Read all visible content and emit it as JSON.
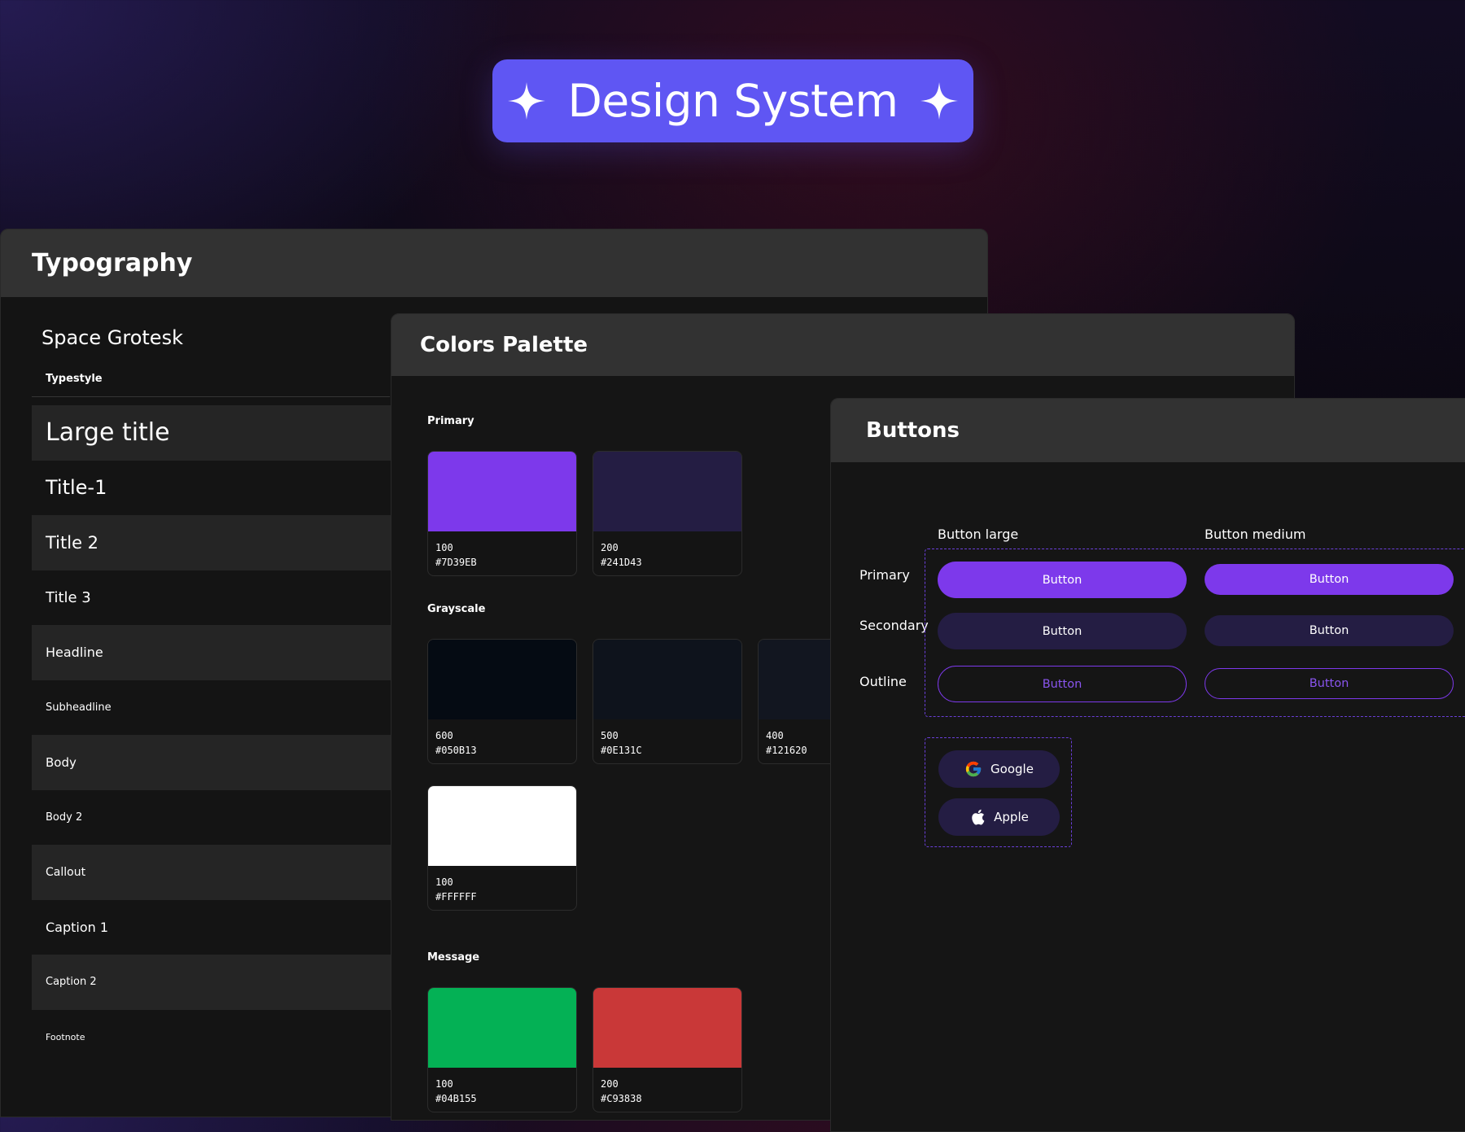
{
  "header": {
    "title": "Design System",
    "icon": "sparkle-icon",
    "accent_color": "#5F56F3"
  },
  "typography": {
    "title": "Typography",
    "font_name": "Space Grotesk",
    "typestyle_label": "Typestyle",
    "styles": [
      "Large title",
      "Title-1",
      "Title 2",
      "Title 3",
      "Headline",
      "Subheadline",
      "Body",
      "Body 2",
      "Callout",
      "Caption 1",
      "Caption 2",
      "Footnote"
    ]
  },
  "colors": {
    "title": "Colors Palette",
    "sections": {
      "primary": {
        "label": "Primary",
        "swatches": [
          {
            "shade": "100",
            "hex": "#7D39EB"
          },
          {
            "shade": "200",
            "hex": "#241D43"
          }
        ]
      },
      "grayscale": {
        "label": "Grayscale",
        "swatches": [
          {
            "shade": "600",
            "hex": "#050B13"
          },
          {
            "shade": "500",
            "hex": "#0E131C"
          },
          {
            "shade": "400",
            "hex": "#121620"
          },
          {
            "shade": "100",
            "hex": "#FFFFFF"
          }
        ]
      },
      "message": {
        "label": "Message",
        "swatches": [
          {
            "shade": "100",
            "hex": "#04B155"
          },
          {
            "shade": "200",
            "hex": "#C93838"
          }
        ]
      }
    }
  },
  "buttons": {
    "title": "Buttons",
    "columns": {
      "large": "Button large",
      "medium": "Button medium"
    },
    "rows": {
      "primary": "Primary",
      "secondary": "Secondary",
      "outline": "Outline"
    },
    "button_label": "Button",
    "social": {
      "google": {
        "label": "Google",
        "icon": "google-icon"
      },
      "apple": {
        "label": "Apple",
        "icon": "apple-icon"
      }
    }
  }
}
